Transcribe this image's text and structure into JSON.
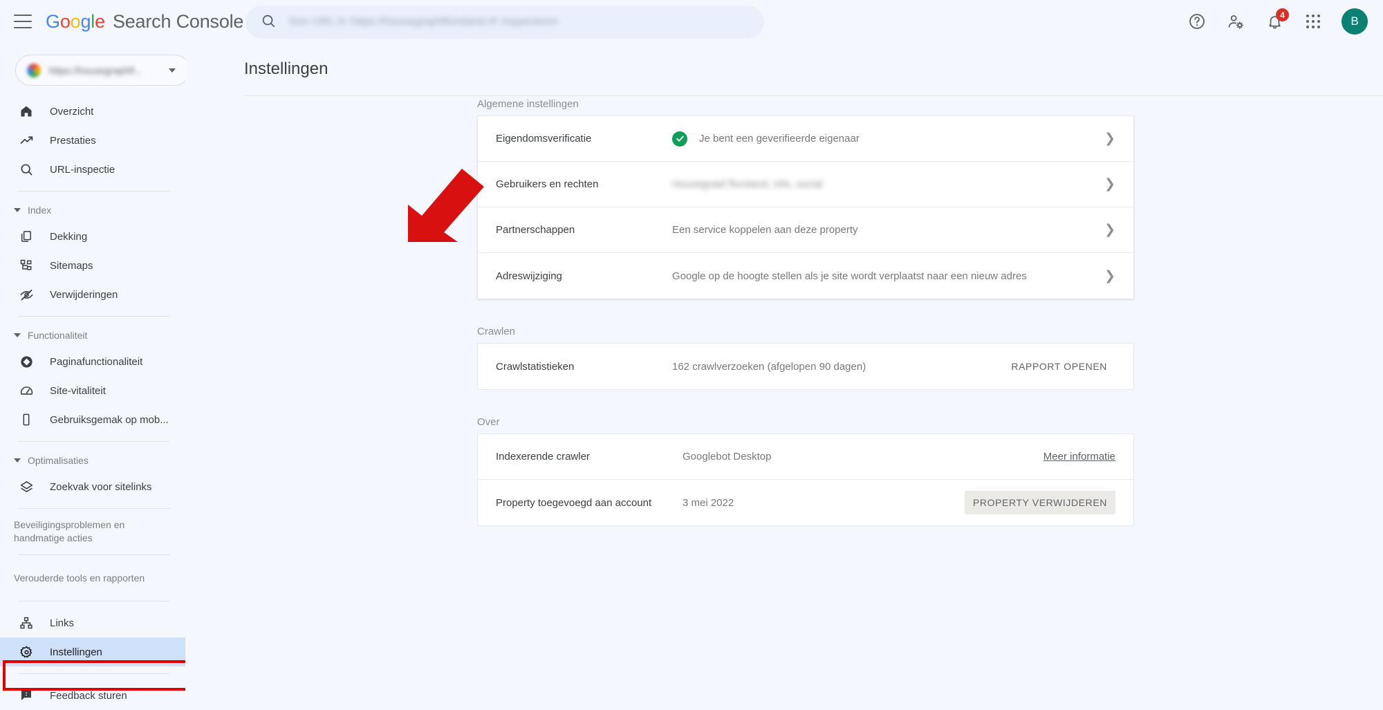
{
  "header": {
    "logo_parts": [
      "G",
      "o",
      "o",
      "g",
      "l",
      "e"
    ],
    "product_name": "Search Console",
    "search_placeholder": "Een URL in 'https://housegraphflorsland.nl' inspecteren",
    "notification_count": "4",
    "avatar_initial": "B",
    "icons": {
      "menu": "hamburger-icon",
      "search": "search-icon",
      "help": "help-icon",
      "account_settings": "account-settings-icon",
      "notifications": "bell-icon",
      "apps": "apps-grid-icon"
    }
  },
  "sidebar": {
    "property_selector": {
      "value": "https://housegraphfl...",
      "caret": "chevron-down-icon"
    },
    "items": [
      {
        "label": "Overzicht",
        "icon": "home-icon",
        "type": "item"
      },
      {
        "label": "Prestaties",
        "icon": "trending-up-icon",
        "type": "item"
      },
      {
        "label": "URL-inspectie",
        "icon": "search-icon",
        "type": "item"
      }
    ],
    "index_group": {
      "label": "Index",
      "expanded": true
    },
    "index_items": [
      {
        "label": "Dekking",
        "icon": "pages-icon"
      },
      {
        "label": "Sitemaps",
        "icon": "sitemap-icon"
      },
      {
        "label": "Verwijderingen",
        "icon": "eye-off-icon"
      }
    ],
    "feature_group": {
      "label": "Functionaliteit",
      "expanded": true
    },
    "feature_items": [
      {
        "label": "Paginafunctionaliteit",
        "icon": "page-experience-icon"
      },
      {
        "label": "Site-vitaliteit",
        "icon": "speedometer-icon"
      },
      {
        "label": "Gebruiksgemak op mob...",
        "icon": "mobile-icon"
      }
    ],
    "optimization_group": {
      "label": "Optimalisaties",
      "expanded": true
    },
    "optimization_items": [
      {
        "label": "Zoekvak voor sitelinks",
        "icon": "layers-icon"
      }
    ],
    "collapsed_groups": [
      {
        "label": "Beveiligingsproblemen en handmatige acties"
      },
      {
        "label": "Verouderde tools en rapporten"
      }
    ],
    "bottom_items": [
      {
        "label": "Links",
        "icon": "links-icon",
        "active": false
      },
      {
        "label": "Instellingen",
        "icon": "gear-icon",
        "active": true
      },
      {
        "label": "Feedback sturen",
        "icon": "feedback-icon",
        "active": false
      }
    ]
  },
  "main": {
    "page_title": "Instellingen",
    "sections": [
      {
        "label": "Algemene instellingen",
        "rows": [
          {
            "label": "Eigendomsverificatie",
            "value": "Je bent een geverifieerde eigenaar",
            "status": "verified",
            "action": "chevron"
          },
          {
            "label": "Gebruikers en rechten",
            "value": "Housegraaf florsland, info, social",
            "blurred": true,
            "action": "chevron"
          },
          {
            "label": "Partnerschappen",
            "value": "Een service koppelen aan deze property",
            "action": "chevron"
          },
          {
            "label": "Adreswijziging",
            "value": "Google op de hoogte stellen als je site wordt verplaatst naar een nieuw adres",
            "action": "chevron"
          }
        ]
      },
      {
        "label": "Crawlen",
        "rows": [
          {
            "label": "Crawlstatistieken",
            "value": "162 crawlverzoeken (afgelopen 90 dagen)",
            "action": "button",
            "button_label": "RAPPORT OPENEN"
          }
        ]
      },
      {
        "label": "Over",
        "rows": [
          {
            "label": "Indexerende crawler",
            "value": "Googlebot Desktop",
            "action": "link",
            "link_label": "Meer informatie"
          },
          {
            "label": "Property toegevoegd aan account",
            "value": "3 mei 2022",
            "action": "filled-button",
            "button_label": "PROPERTY VERWIJDEREN"
          }
        ]
      }
    ]
  },
  "annotations": {
    "arrow_color": "#d81010",
    "highlight_border_color": "#e00000",
    "highlight_target": "Instellingen"
  },
  "colors": {
    "accent_blue": "#4285F4",
    "verified_green": "#0f9d58",
    "avatar_bg": "#0b8174",
    "badge_red": "#d93025",
    "page_bg": "#f4f7fd",
    "active_nav_bg": "#cfe0f9"
  }
}
